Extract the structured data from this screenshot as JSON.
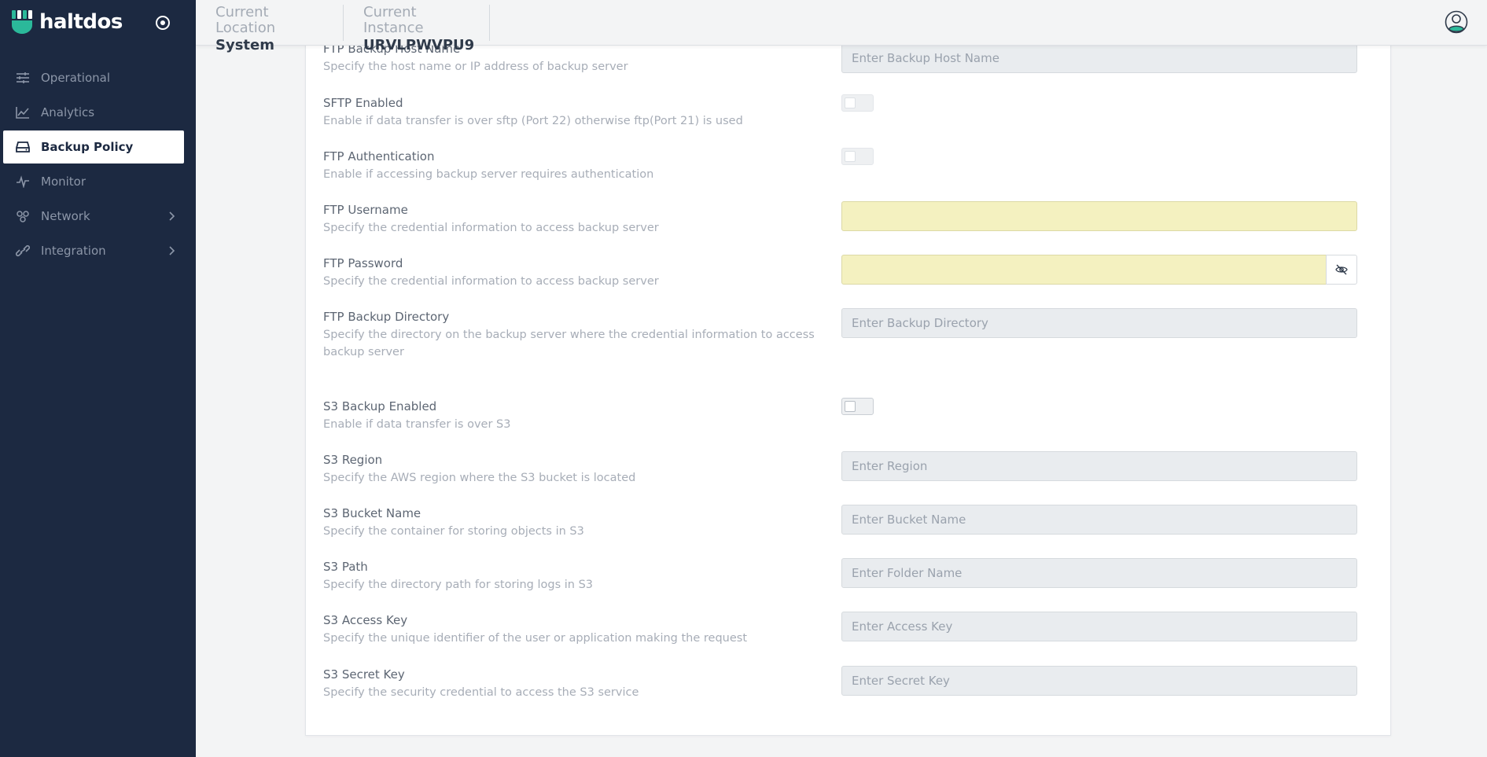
{
  "brand": {
    "name": "haltdos"
  },
  "sidebar": {
    "items": [
      {
        "label": "Operational",
        "icon": "sliders-icon",
        "active": false,
        "chevron": false
      },
      {
        "label": "Analytics",
        "icon": "chart-line-icon",
        "active": false,
        "chevron": false
      },
      {
        "label": "Backup Policy",
        "icon": "hard-drive-icon",
        "active": true,
        "chevron": false
      },
      {
        "label": "Monitor",
        "icon": "pulse-icon",
        "active": false,
        "chevron": false
      },
      {
        "label": "Network",
        "icon": "network-icon",
        "active": false,
        "chevron": true
      },
      {
        "label": "Integration",
        "icon": "link-icon",
        "active": false,
        "chevron": true
      }
    ]
  },
  "header": {
    "location_label": "Current Location",
    "location_value": "System",
    "instance_label": "Current Instance",
    "instance_value": "URVLPWVPU9"
  },
  "form": {
    "ftp_host": {
      "title": "FTP Backup Host Name",
      "desc": "Specify the host name or IP address of backup server",
      "placeholder": "Enter Backup Host Name"
    },
    "sftp": {
      "title": "SFTP Enabled",
      "desc": "Enable if data transfer is over sftp (Port 22) otherwise ftp(Port 21) is used",
      "enabled": false
    },
    "ftp_auth": {
      "title": "FTP Authentication",
      "desc": "Enable if accessing backup server requires authentication",
      "enabled": false
    },
    "ftp_username": {
      "title": "FTP Username",
      "desc": "Specify the credential information to access backup server",
      "value": ""
    },
    "ftp_password": {
      "title": "FTP Password",
      "desc": "Specify the credential information to access backup server",
      "value": ""
    },
    "ftp_dir": {
      "title": "FTP Backup Directory",
      "desc": "Specify the directory on the backup server where the credential information to access backup server",
      "placeholder": "Enter Backup Directory"
    },
    "s3_enabled": {
      "title": "S3 Backup Enabled",
      "desc": "Enable if data transfer is over S3",
      "enabled": false
    },
    "s3_region": {
      "title": "S3 Region",
      "desc": "Specify the AWS region where the S3 bucket is located",
      "placeholder": "Enter Region"
    },
    "s3_bucket": {
      "title": "S3 Bucket Name",
      "desc": "Specify the container for storing objects in S3",
      "placeholder": "Enter Bucket Name"
    },
    "s3_path": {
      "title": "S3 Path",
      "desc": "Specify the directory path for storing logs in S3",
      "placeholder": "Enter Folder Name"
    },
    "s3_access": {
      "title": "S3 Access Key",
      "desc": "Specify the unique identifier of the user or application making the request",
      "placeholder": "Enter Access Key"
    },
    "s3_secret": {
      "title": "S3 Secret Key",
      "desc": "Specify the security credential to access the S3 service",
      "placeholder": "Enter Secret Key"
    }
  },
  "colors": {
    "sidebar_bg": "#1c2941",
    "brand_accent": "#2bb99a",
    "autofill": "#f4f1c0"
  }
}
